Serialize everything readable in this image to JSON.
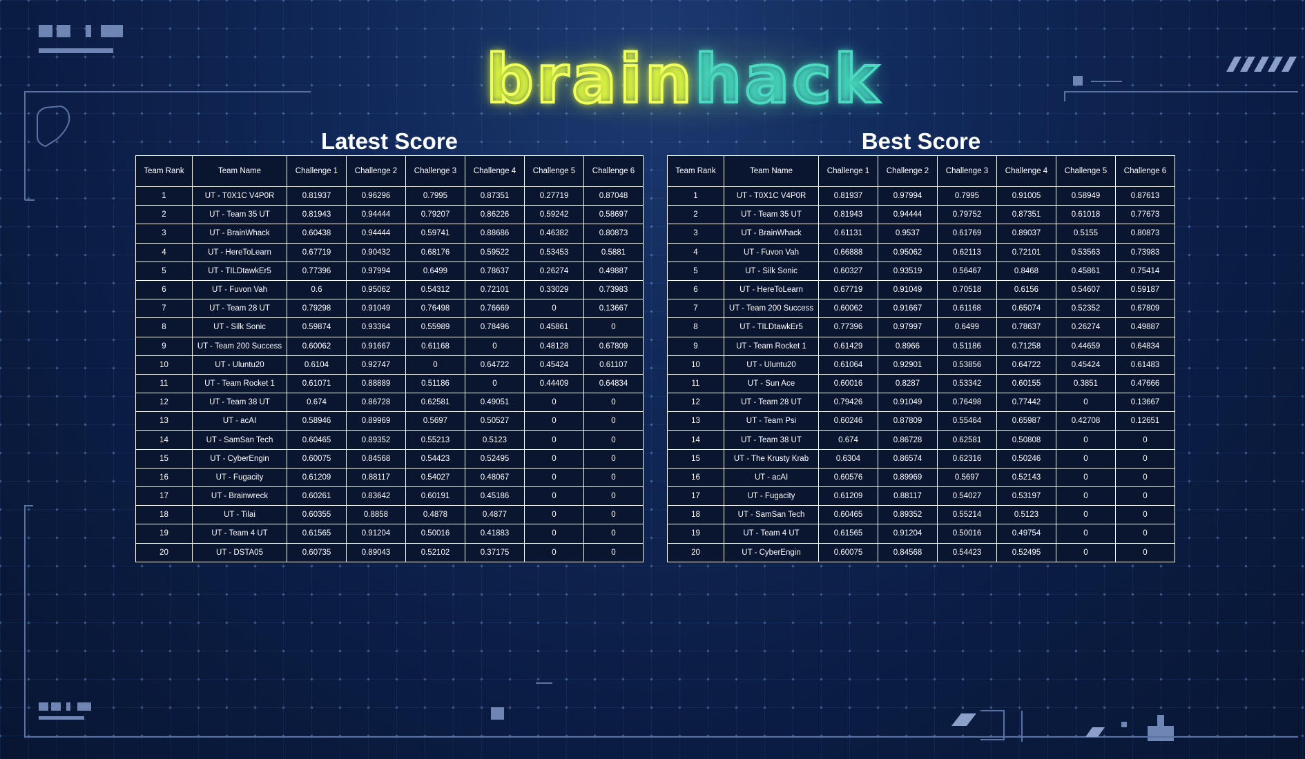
{
  "logo": {
    "part1": "brain",
    "part2": "hack"
  },
  "colors": {
    "brain": "#f1ff5a",
    "hack": "#4bdac0",
    "background": "#0b1d44"
  },
  "columns": [
    "Team Rank",
    "Team Name",
    "Challenge 1",
    "Challenge 2",
    "Challenge 3",
    "Challenge 4",
    "Challenge 5",
    "Challenge 6"
  ],
  "latest": {
    "title": "Latest Score",
    "rows": [
      [
        "1",
        "UT - T0X1C V4P0R",
        "0.81937",
        "0.96296",
        "0.7995",
        "0.87351",
        "0.27719",
        "0.87048"
      ],
      [
        "2",
        "UT - Team 35 UT",
        "0.81943",
        "0.94444",
        "0.79207",
        "0.86226",
        "0.59242",
        "0.58697"
      ],
      [
        "3",
        "UT - BrainWhack",
        "0.60438",
        "0.94444",
        "0.59741",
        "0.88686",
        "0.46382",
        "0.80873"
      ],
      [
        "4",
        "UT - HereToLearn",
        "0.67719",
        "0.90432",
        "0.68176",
        "0.59522",
        "0.53453",
        "0.5881"
      ],
      [
        "5",
        "UT - TILDtawkEr5",
        "0.77396",
        "0.97994",
        "0.6499",
        "0.78637",
        "0.26274",
        "0.49887"
      ],
      [
        "6",
        "UT - Fuvon Vah",
        "0.6",
        "0.95062",
        "0.54312",
        "0.72101",
        "0.33029",
        "0.73983"
      ],
      [
        "7",
        "UT - Team 28 UT",
        "0.79298",
        "0.91049",
        "0.76498",
        "0.76669",
        "0",
        "0.13667"
      ],
      [
        "8",
        "UT - Silk Sonic",
        "0.59874",
        "0.93364",
        "0.55989",
        "0.78496",
        "0.45861",
        "0"
      ],
      [
        "9",
        "UT - Team 200 Success",
        "0.60062",
        "0.91667",
        "0.61168",
        "0",
        "0.48128",
        "0.67809"
      ],
      [
        "10",
        "UT - Uluntu20",
        "0.6104",
        "0.92747",
        "0",
        "0.64722",
        "0.45424",
        "0.61107"
      ],
      [
        "11",
        "UT - Team Rocket 1",
        "0.61071",
        "0.88889",
        "0.51186",
        "0",
        "0.44409",
        "0.64834"
      ],
      [
        "12",
        "UT - Team 38 UT",
        "0.674",
        "0.86728",
        "0.62581",
        "0.49051",
        "0",
        "0"
      ],
      [
        "13",
        "UT - acAI",
        "0.58946",
        "0.89969",
        "0.5697",
        "0.50527",
        "0",
        "0"
      ],
      [
        "14",
        "UT - SamSan Tech",
        "0.60465",
        "0.89352",
        "0.55213",
        "0.5123",
        "0",
        "0"
      ],
      [
        "15",
        "UT - CyberEngin",
        "0.60075",
        "0.84568",
        "0.54423",
        "0.52495",
        "0",
        "0"
      ],
      [
        "16",
        "UT - Fugacity",
        "0.61209",
        "0.88117",
        "0.54027",
        "0.48067",
        "0",
        "0"
      ],
      [
        "17",
        "UT - Brainwreck",
        "0.60261",
        "0.83642",
        "0.60191",
        "0.45186",
        "0",
        "0"
      ],
      [
        "18",
        "UT - Tilai",
        "0.60355",
        "0.8858",
        "0.4878",
        "0.4877",
        "0",
        "0"
      ],
      [
        "19",
        "UT - Team 4 UT",
        "0.61565",
        "0.91204",
        "0.50016",
        "0.41883",
        "0",
        "0"
      ],
      [
        "20",
        "UT - DSTA05",
        "0.60735",
        "0.89043",
        "0.52102",
        "0.37175",
        "0",
        "0"
      ]
    ]
  },
  "best": {
    "title": "Best Score",
    "rows": [
      [
        "1",
        "UT - T0X1C V4P0R",
        "0.81937",
        "0.97994",
        "0.7995",
        "0.91005",
        "0.58949",
        "0.87613"
      ],
      [
        "2",
        "UT - Team 35 UT",
        "0.81943",
        "0.94444",
        "0.79752",
        "0.87351",
        "0.61018",
        "0.77673"
      ],
      [
        "3",
        "UT - BrainWhack",
        "0.61131",
        "0.9537",
        "0.61769",
        "0.89037",
        "0.5155",
        "0.80873"
      ],
      [
        "4",
        "UT - Fuvon Vah",
        "0.66888",
        "0.95062",
        "0.62113",
        "0.72101",
        "0.53563",
        "0.73983"
      ],
      [
        "5",
        "UT - Silk Sonic",
        "0.60327",
        "0.93519",
        "0.56467",
        "0.8468",
        "0.45861",
        "0.75414"
      ],
      [
        "6",
        "UT - HereToLearn",
        "0.67719",
        "0.91049",
        "0.70518",
        "0.6156",
        "0.54607",
        "0.59187"
      ],
      [
        "7",
        "UT - Team 200 Success",
        "0.60062",
        "0.91667",
        "0.61168",
        "0.65074",
        "0.52352",
        "0.67809"
      ],
      [
        "8",
        "UT - TILDtawkEr5",
        "0.77396",
        "0.97997",
        "0.6499",
        "0.78637",
        "0.26274",
        "0.49887"
      ],
      [
        "9",
        "UT - Team Rocket 1",
        "0.61429",
        "0.8966",
        "0.51186",
        "0.71258",
        "0.44659",
        "0.64834"
      ],
      [
        "10",
        "UT - Uluntu20",
        "0.61064",
        "0.92901",
        "0.53856",
        "0.64722",
        "0.45424",
        "0.61483"
      ],
      [
        "11",
        "UT - Sun Ace",
        "0.60016",
        "0.8287",
        "0.53342",
        "0.60155",
        "0.3851",
        "0.47666"
      ],
      [
        "12",
        "UT - Team 28 UT",
        "0.79426",
        "0.91049",
        "0.76498",
        "0.77442",
        "0",
        "0.13667"
      ],
      [
        "13",
        "UT - Team Psi",
        "0.60246",
        "0.87809",
        "0.55464",
        "0.65987",
        "0.42708",
        "0.12651"
      ],
      [
        "14",
        "UT - Team 38 UT",
        "0.674",
        "0.86728",
        "0.62581",
        "0.50808",
        "0",
        "0"
      ],
      [
        "15",
        "UT - The Krusty Krab",
        "0.6304",
        "0.86574",
        "0.62316",
        "0.50246",
        "0",
        "0"
      ],
      [
        "16",
        "UT - acAI",
        "0.60576",
        "0.89969",
        "0.5697",
        "0.52143",
        "0",
        "0"
      ],
      [
        "17",
        "UT - Fugacity",
        "0.61209",
        "0.88117",
        "0.54027",
        "0.53197",
        "0",
        "0"
      ],
      [
        "18",
        "UT - SamSan Tech",
        "0.60465",
        "0.89352",
        "0.55214",
        "0.5123",
        "0",
        "0"
      ],
      [
        "19",
        "UT - Team 4 UT",
        "0.61565",
        "0.91204",
        "0.50016",
        "0.49754",
        "0",
        "0"
      ],
      [
        "20",
        "UT - CyberEngin",
        "0.60075",
        "0.84568",
        "0.54423",
        "0.52495",
        "0",
        "0"
      ]
    ]
  }
}
